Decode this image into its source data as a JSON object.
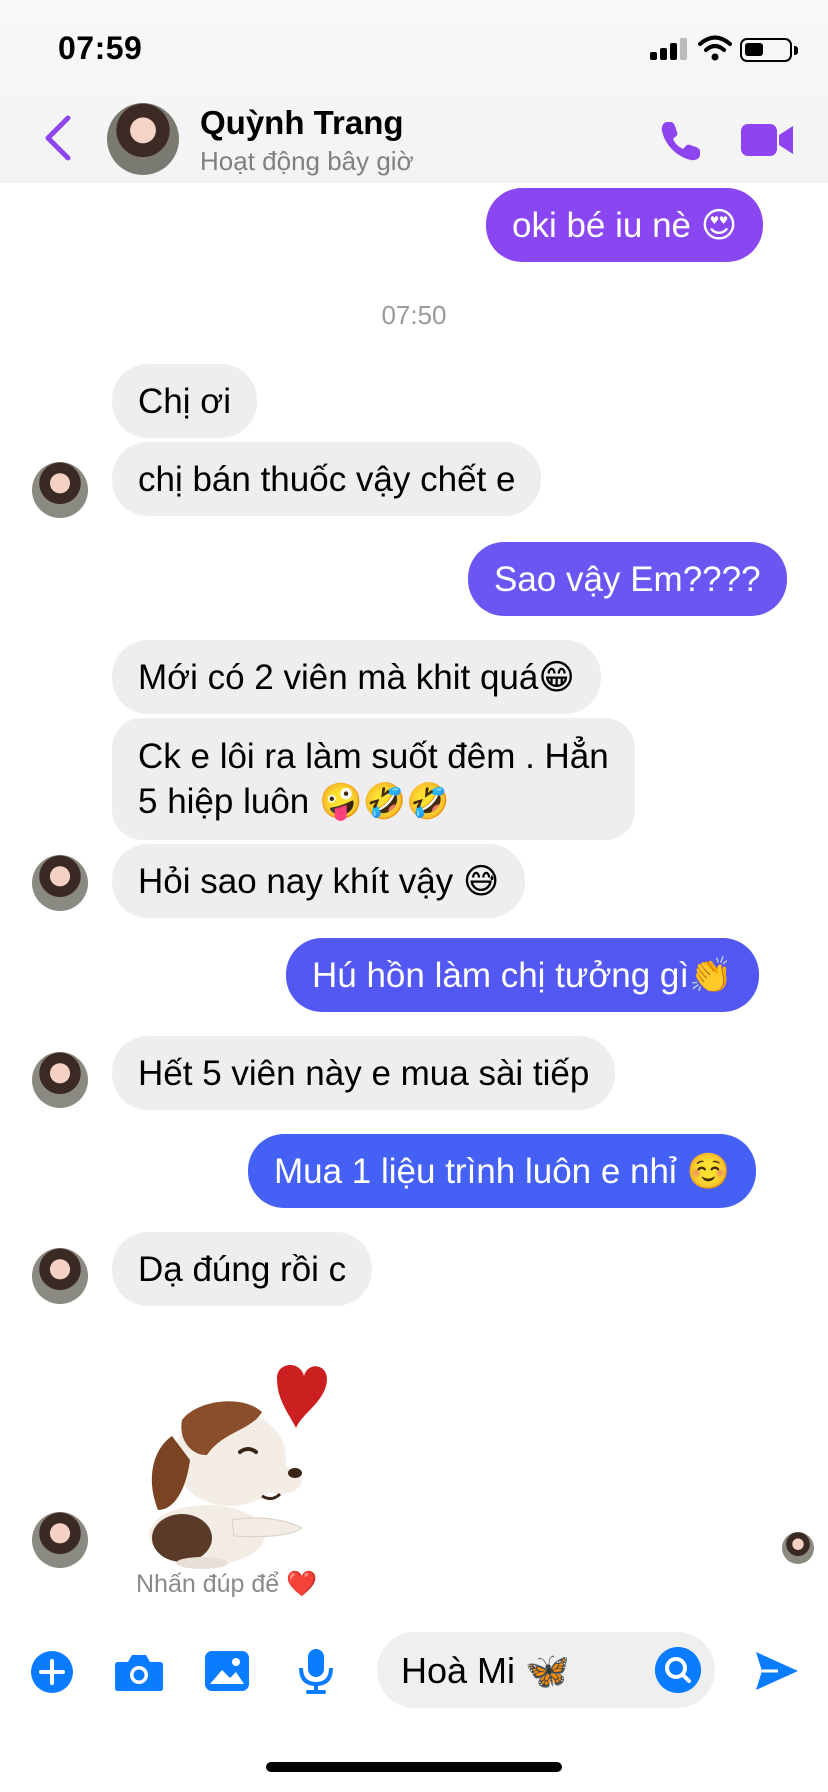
{
  "status": {
    "time": "07:59"
  },
  "header": {
    "name": "Quỳnh Trang",
    "presence": "Hoạt động bây giờ"
  },
  "timestamp": "07:50",
  "messages": [
    {
      "dir": "out",
      "text": "oki bé iu nè 😍"
    },
    {
      "dir": "in",
      "text": "Chị ơi"
    },
    {
      "dir": "in",
      "text": "chị bán thuốc vậy chết e"
    },
    {
      "dir": "out",
      "text": "Sao vậy Em????"
    },
    {
      "dir": "in",
      "text": "Mới có 2 viên mà khit quá😁"
    },
    {
      "dir": "in",
      "line1": "Ck e lôi ra làm suốt đêm . Hẳn",
      "line2": "5 hiệp luôn 🤪🤣🤣"
    },
    {
      "dir": "in",
      "text": "Hỏi sao nay khít vậy 😅"
    },
    {
      "dir": "out",
      "text": "Hú hồn làm chị tưởng gì👏"
    },
    {
      "dir": "in",
      "text": "Hết 5 viên này e mua sài tiếp"
    },
    {
      "dir": "out",
      "text": "Mua 1 liệu trình luôn e nhỉ ☺️"
    },
    {
      "dir": "in",
      "text": "Dạ đúng rồi c"
    }
  ],
  "sticker_hint": "Nhấn đúp để ❤️",
  "composer": {
    "input_value": "Hoà Mi 🦋"
  },
  "icons": [
    "back-chevron-icon",
    "phone-icon",
    "video-icon",
    "plus-icon",
    "camera-icon",
    "image-icon",
    "microphone-icon",
    "emoji-icon",
    "send-icon"
  ],
  "colors": {
    "accent_top": "#8e45f0",
    "accent_bottom": "#3d6cf5",
    "incoming": "#eeeeef",
    "icon_blue": "#0a7cff"
  }
}
